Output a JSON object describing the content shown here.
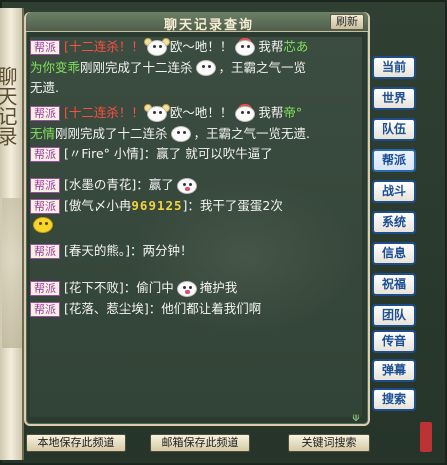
{
  "window": {
    "title": "聊天记录查询",
    "refresh_label": "刷新"
  },
  "left_scroll": {
    "text": "聊天记录"
  },
  "tag_label": "帮派",
  "messages": [
    {
      "prefix": "[十二连杀！！",
      "tail": "欧～吔！！",
      "rest1": "我帮",
      "rest2": "芯あ",
      "line2_green": "为你变乖",
      "line2_text": "刚刚完成了十二连杀",
      "line2_text2": "，王霸之气一览",
      "line3_text": "无遗."
    },
    {
      "prefix": "[十二连杀！！",
      "tail": "欧～吔！！",
      "rest1": "我帮",
      "rest2": "帝°",
      "line2_green": "无情",
      "line2_text": "刚刚完成了十二连杀",
      "line2_text2": "，王霸之气一览无遗."
    },
    {
      "text": "[〃Fire° 小情]：赢了  就可以吹牛逼了"
    },
    {
      "text": "[水墨の青花]：赢了"
    },
    {
      "text": "[傲气〆小冉",
      "num": "969125",
      "text2": "]：我干了蛋蛋2次"
    },
    {
      "text": "[春天的熊。]：两分钟！"
    },
    {
      "text": "[花下不败]：偷门中",
      "text2": "掩护我"
    },
    {
      "text": "[花落、惹尘埃]：他们都让着我们啊"
    }
  ],
  "side_menu": [
    {
      "label": "当前",
      "icon": "current-tab"
    },
    {
      "label": "世界",
      "icon": "world-tab"
    },
    {
      "label": "队伍",
      "icon": "team-tab"
    },
    {
      "label": "帮派",
      "icon": "guild-tab",
      "active": true
    },
    {
      "label": "战斗",
      "icon": "battle-tab"
    },
    {
      "label": "系统",
      "icon": "system-tab"
    },
    {
      "label": "信息",
      "icon": "info-tab"
    },
    {
      "label": "祝福",
      "icon": "blessing-tab"
    },
    {
      "label": "团队",
      "icon": "group-tab"
    }
  ],
  "side_menu2": [
    {
      "label": "传音"
    },
    {
      "label": "弹幕"
    },
    {
      "label": "搜索"
    }
  ],
  "bottom": {
    "local_save": "本地保存此频道",
    "mail_save": "邮箱保存此频道",
    "keyword_search": "关键词搜索"
  },
  "resize_symbol": "⟱",
  "colors": {
    "accent": "#1c4f94",
    "highlight": "#ff4d3f",
    "guild_tag": "#9b3aa2"
  }
}
